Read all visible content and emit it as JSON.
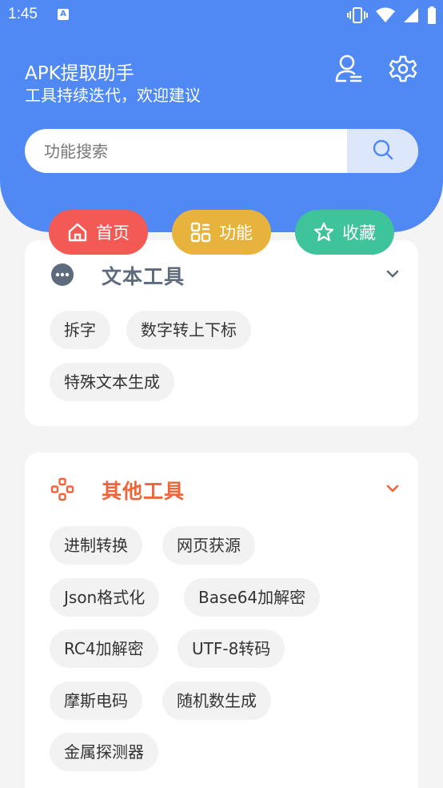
{
  "status": {
    "time": "1:45"
  },
  "header": {
    "title": "APK提取助手",
    "subtitle": "工具持续迭代，欢迎建议",
    "search_placeholder": "功能搜索"
  },
  "nav": [
    {
      "label": "首页",
      "color": "#f35a55",
      "icon": "home-icon"
    },
    {
      "label": "功能",
      "color": "#e8b33c",
      "icon": "grid-icon"
    },
    {
      "label": "收藏",
      "color": "#3fc39a",
      "icon": "star-icon"
    }
  ],
  "sections": [
    {
      "title": "文本工具",
      "title_color": "#5e6b7c",
      "icon": "chat-dots-icon",
      "items": [
        "拆字",
        "数字转上下标",
        "特殊文本生成"
      ]
    },
    {
      "title": "其他工具",
      "title_color": "#f0643a",
      "icon": "gamepad-icon",
      "items": [
        "进制转换",
        "网页获源",
        "Json格式化",
        "Base64加解密",
        "RC4加解密",
        "UTF-8转码",
        "摩斯电码",
        "随机数生成",
        "金属探测器"
      ]
    }
  ]
}
